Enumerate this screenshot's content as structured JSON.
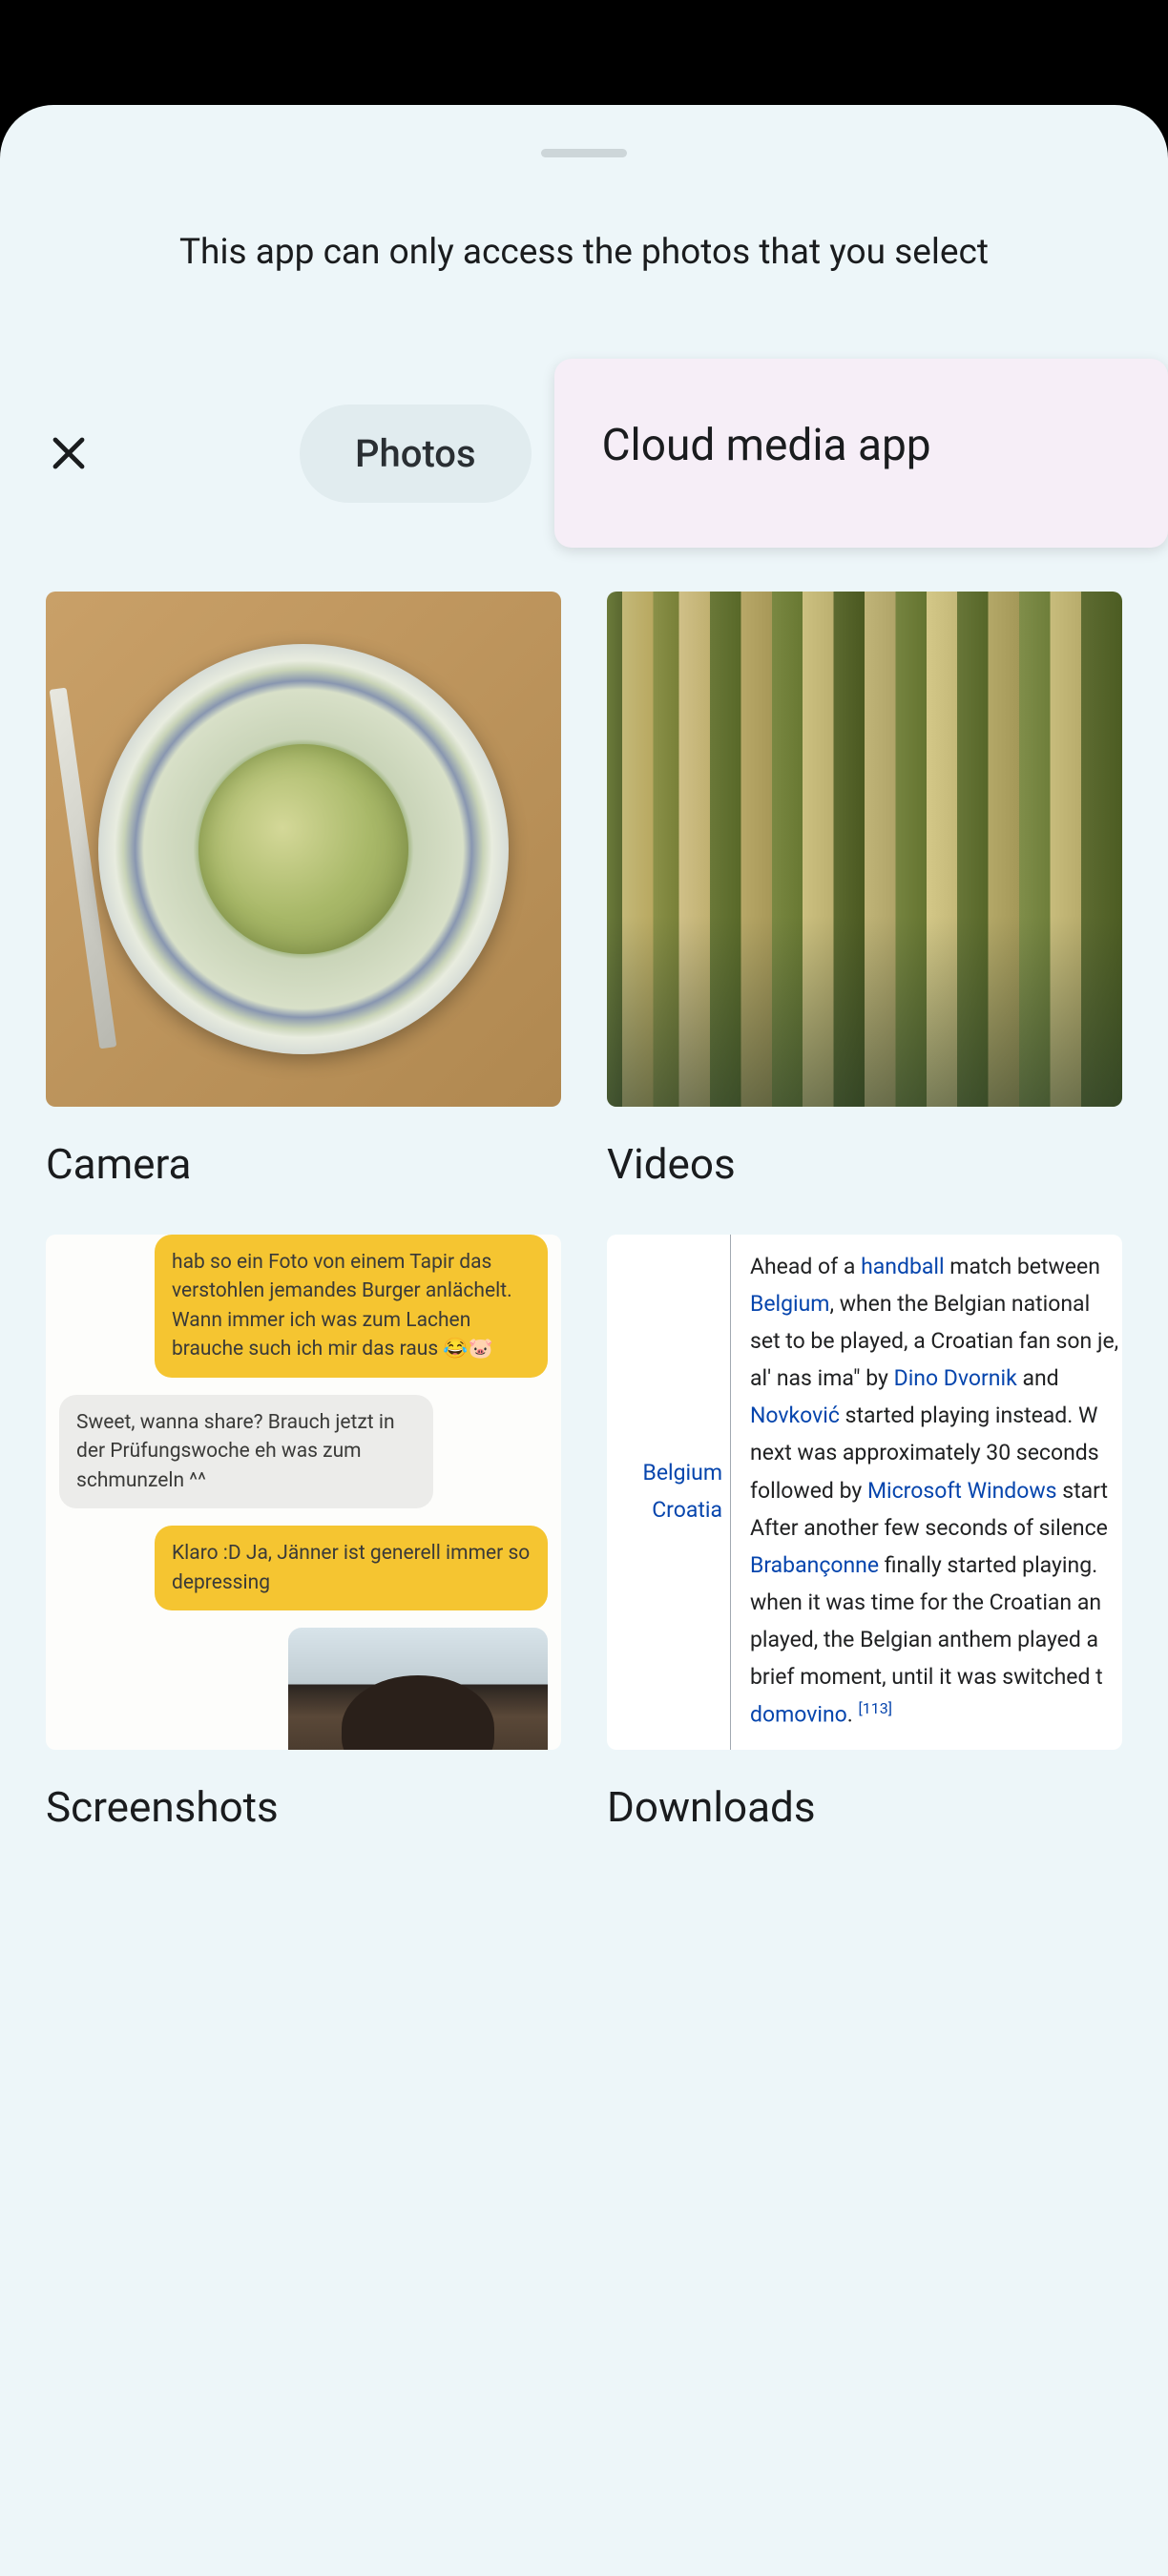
{
  "notice": "This app can only access the photos that you select",
  "toolbar": {
    "pill_label": "Photos",
    "card_label": "Cloud media app"
  },
  "albums": [
    {
      "title": "Camera"
    },
    {
      "title": "Videos"
    },
    {
      "title": "Screenshots"
    },
    {
      "title": "Downloads"
    }
  ],
  "screenshots_chat": {
    "msg1": "hab so ein Foto von einem Tapir das verstohlen jemandes Burger anlächelt. Wann immer ich was zum Lachen brauche such ich mir das raus 😂🐷",
    "msg2": "Sweet, wanna share? Brauch jetzt in der Prüfungswoche eh was zum schmunzeln ^^",
    "msg3": "Klaro :D  Ja, Jänner ist generell immer so depressing"
  },
  "downloads_article": {
    "side1": "Belgium",
    "side2": "Croatia",
    "t1": "Ahead of a ",
    "l1": "handball",
    "t2": " match between ",
    "l2": "Belgium",
    "t3": ", when the Belgian national set to be played, a Croatian fan son je, al' nas ima\" by ",
    "l3": "Dino Dvornik",
    "t4": " and ",
    "l4": "Novković",
    "t5": " started playing instead. W next was approximately 30 seconds followed by ",
    "l5": "Microsoft Windows",
    "t6": " start After another few seconds of silence ",
    "l6": "Brabançonne",
    "t7": " finally started playing. when it was time for the Croatian an played, the Belgian anthem played a brief moment, until it was switched t ",
    "l7": "domovino",
    "t8": ". ",
    "ref": "[113]"
  }
}
